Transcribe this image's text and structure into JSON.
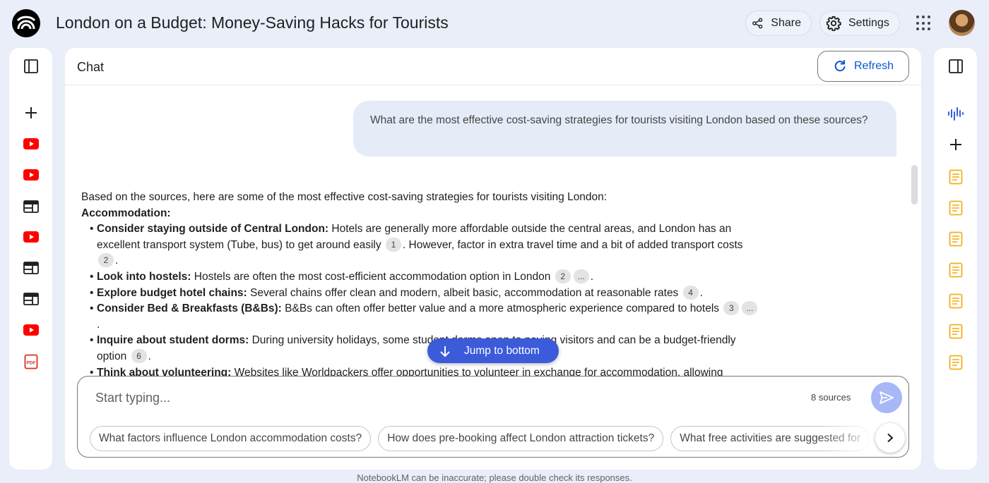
{
  "header": {
    "title": "London on a Budget: Money-Saving Hacks for Tourists",
    "share_label": "Share",
    "settings_label": "Settings"
  },
  "left_sidebar": {
    "items": [
      {
        "icon": "add-icon",
        "type": "add"
      },
      {
        "icon": "youtube-icon",
        "type": "youtube"
      },
      {
        "icon": "youtube-icon",
        "type": "youtube"
      },
      {
        "icon": "web-icon",
        "type": "web"
      },
      {
        "icon": "youtube-icon",
        "type": "youtube"
      },
      {
        "icon": "web-icon",
        "type": "web"
      },
      {
        "icon": "web-icon",
        "type": "web"
      },
      {
        "icon": "youtube-icon",
        "type": "youtube"
      },
      {
        "icon": "pdf-icon",
        "type": "pdf"
      }
    ]
  },
  "right_sidebar": {
    "items": [
      {
        "icon": "audio-overview-icon"
      },
      {
        "icon": "add-note-icon"
      },
      {
        "icon": "note-icon"
      },
      {
        "icon": "note-icon"
      },
      {
        "icon": "note-icon"
      },
      {
        "icon": "note-icon"
      },
      {
        "icon": "note-icon"
      },
      {
        "icon": "note-icon"
      },
      {
        "icon": "note-icon"
      }
    ]
  },
  "chat": {
    "label": "Chat",
    "refresh_label": "Refresh",
    "user_message": "What are the most effective cost-saving strategies for tourists visiting London based on these sources?",
    "answer": {
      "intro": "Based on the sources, here are some of the most effective cost-saving strategies for tourists visiting London:",
      "section_heading": "Accommodation:",
      "items": [
        {
          "bold": "Consider staying outside of Central London:",
          "text": " Hotels are generally more affordable outside the central areas, and London has an excellent transport system (Tube, bus) to get around easily ",
          "cite1": "1",
          "text2": ". However, factor in extra travel time and a bit of added transport costs ",
          "cite2": "2",
          "end": "."
        },
        {
          "bold": "Look into hostels:",
          "text": " Hostels are often the most cost-efficient accommodation option in London ",
          "cite1": "2",
          "cite2": "...",
          "end": "."
        },
        {
          "bold": "Explore budget hotel chains:",
          "text": " Several chains offer clean and modern, albeit basic, accommodation at reasonable rates ",
          "cite1": "4",
          "end": "."
        },
        {
          "bold": "Consider Bed & Breakfasts (B&Bs):",
          "text": " B&Bs can often offer better value and a more atmospheric experience compared to hotels ",
          "cite1": "3",
          "cite2": "...",
          "end": "."
        },
        {
          "bold": "Inquire about student dorms:",
          "text": " During university holidays, some student dorms open to paying visitors and can be a budget-friendly option ",
          "cite1": "6",
          "end": "."
        },
        {
          "bold": "Think about volunteering:",
          "text": " Websites like Worldpackers offer opportunities to volunteer in exchange for accommodation, allowing"
        }
      ]
    },
    "jump_label": "Jump to bottom"
  },
  "composer": {
    "placeholder": "Start typing...",
    "sources_count": "8 sources",
    "suggestions": [
      "What factors influence London accommodation costs?",
      "How does pre-booking affect London attraction tickets?",
      "What free activities are suggested for"
    ]
  },
  "footer_note": "NotebookLM can be inaccurate; please double check its responses.",
  "colors": {
    "background": "#e9eef9",
    "accent_blue": "#0b57d0",
    "jump_button": "#3b5bdb",
    "youtube_red": "#ff0000",
    "note_yellow": "#f2b01e",
    "audio_blue": "#3b5bdb"
  }
}
